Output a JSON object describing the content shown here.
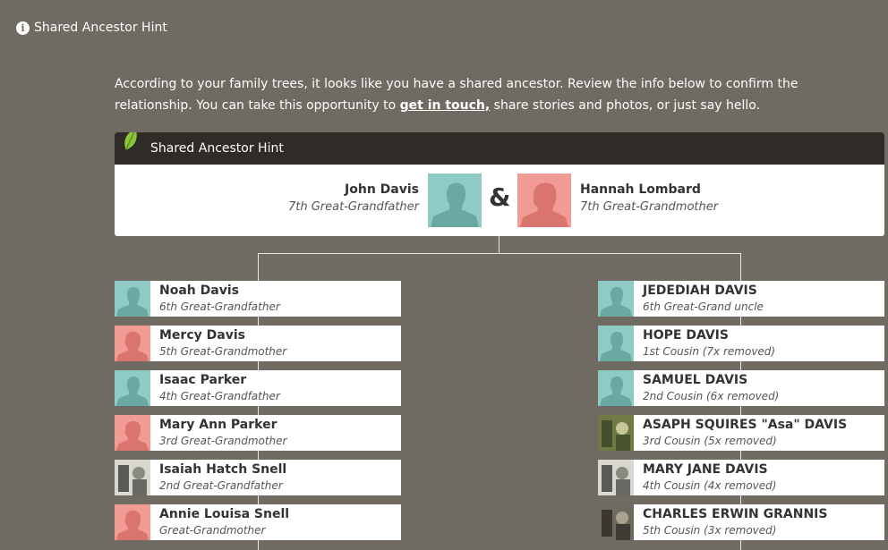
{
  "header": {
    "title": "Shared Ancestor Hint"
  },
  "intro": {
    "before": "According to your family trees, it looks like you have a shared ancestor. Review the info below to confirm the relationship. You can take this opportunity to ",
    "link": "get in touch,",
    "after": " share stories and photos, or just say hello."
  },
  "card": {
    "title": "Shared Ancestor Hint",
    "ampersand": "&",
    "ancestor_left": {
      "name": "John Davis",
      "relation": "7th Great-Grandfather"
    },
    "ancestor_right": {
      "name": "Hannah Lombard",
      "relation": "7th Great-Grandmother"
    }
  },
  "colors": {
    "male": "#8fcbc4",
    "female": "#f09b93",
    "header": "#2f2b26",
    "background": "#6f6a62"
  },
  "left_line": [
    {
      "name": "Noah Davis",
      "relation": "6th Great-Grandfather",
      "avatar": "male-silhouette"
    },
    {
      "name": "Mercy Davis",
      "relation": "5th Great-Grandmother",
      "avatar": "female-silhouette"
    },
    {
      "name": "Isaac Parker",
      "relation": "4th Great-Grandfather",
      "avatar": "male-silhouette"
    },
    {
      "name": "Mary Ann Parker",
      "relation": "3rd Great-Grandmother",
      "avatar": "female-silhouette"
    },
    {
      "name": "Isaiah Hatch Snell",
      "relation": "2nd Great-Grandfather",
      "avatar": "photo"
    },
    {
      "name": "Annie Louisa Snell",
      "relation": "Great-Grandmother",
      "avatar": "female-silhouette"
    }
  ],
  "right_line": [
    {
      "name": "JEDEDIAH DAVIS",
      "relation": "6th Great-Grand uncle",
      "avatar": "male-silhouette"
    },
    {
      "name": "HOPE DAVIS",
      "relation": "1st Cousin (7x removed)",
      "avatar": "male-silhouette"
    },
    {
      "name": "SAMUEL DAVIS",
      "relation": "2nd Cousin (6x removed)",
      "avatar": "male-silhouette"
    },
    {
      "name": "ASAPH SQUIRES \"Asa\" DAVIS",
      "relation": "3rd Cousin (5x removed)",
      "avatar": "photo"
    },
    {
      "name": "MARY JANE DAVIS",
      "relation": "4th Cousin (4x removed)",
      "avatar": "photo"
    },
    {
      "name": "CHARLES ERWIN GRANNIS",
      "relation": "5th Cousin (3x removed)",
      "avatar": "photo"
    }
  ]
}
